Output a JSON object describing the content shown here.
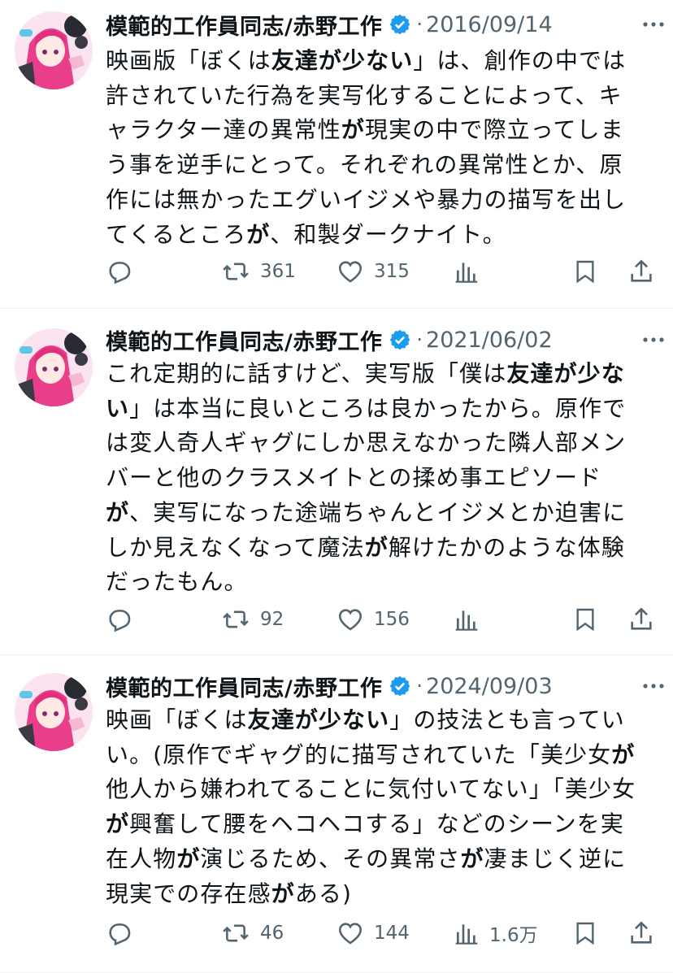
{
  "colors": {
    "accent": "#1d9bf0",
    "secondary_text": "#536471",
    "divider": "#eff3f4"
  },
  "tweets": [
    {
      "author": "模範的工作員同志/赤野工作",
      "date": "2016/09/14",
      "text_segments": [
        {
          "t": "映画版「ぼくは",
          "b": false
        },
        {
          "t": "友達",
          "b": true
        },
        {
          "t": "が",
          "b": true
        },
        {
          "t": "少ない",
          "b": true
        },
        {
          "t": "」は、創作の中では許されていた行為を実写化することによって、キャラクター達の異常性",
          "b": false
        },
        {
          "t": "が",
          "b": true
        },
        {
          "t": "現実の中で際立ってしまう事を逆手にとって。それぞれの異常性とか、原作には無かったエグいイジメや暴力の描写を出してくるところ",
          "b": false
        },
        {
          "t": "が",
          "b": true
        },
        {
          "t": "、和製ダークナイト。",
          "b": false
        }
      ],
      "retweets": "361",
      "likes": "315",
      "views": ""
    },
    {
      "author": "模範的工作員同志/赤野工作",
      "date": "2021/06/02",
      "text_segments": [
        {
          "t": "これ定期的に話すけど、実写版「僕は",
          "b": false
        },
        {
          "t": "友達が少ない",
          "b": true
        },
        {
          "t": "」は本当に良いところは良かったから。原作では変人奇人ギャグにしか思えなかった隣人部メンバーと他のクラスメイトとの揉め事エピソード",
          "b": false
        },
        {
          "t": "が",
          "b": true
        },
        {
          "t": "、実写になった途端ちゃんとイジメとか迫害にしか見えなくなって魔法",
          "b": false
        },
        {
          "t": "が",
          "b": true
        },
        {
          "t": "解けたかのような体験だったもん。",
          "b": false
        }
      ],
      "retweets": "92",
      "likes": "156",
      "views": ""
    },
    {
      "author": "模範的工作員同志/赤野工作",
      "date": "2024/09/03",
      "text_segments": [
        {
          "t": "映画「ぼくは",
          "b": false
        },
        {
          "t": "友達が少ない",
          "b": true
        },
        {
          "t": "」の技法とも言っていい。(原作でギャグ的に描写されていた「美少女",
          "b": false
        },
        {
          "t": "が",
          "b": true
        },
        {
          "t": "他人から嫌われてることに気付いてない」「美少女",
          "b": false
        },
        {
          "t": "が",
          "b": true
        },
        {
          "t": "興奮して腰をヘコヘコする」などのシーンを実在人物",
          "b": false
        },
        {
          "t": "が",
          "b": true
        },
        {
          "t": "演じるため、その異常さ",
          "b": false
        },
        {
          "t": "が",
          "b": true
        },
        {
          "t": "凄まじく逆に現実での存在感",
          "b": false
        },
        {
          "t": "が",
          "b": true
        },
        {
          "t": "ある)",
          "b": false
        }
      ],
      "retweets": "46",
      "likes": "144",
      "views": "1.6万"
    }
  ]
}
